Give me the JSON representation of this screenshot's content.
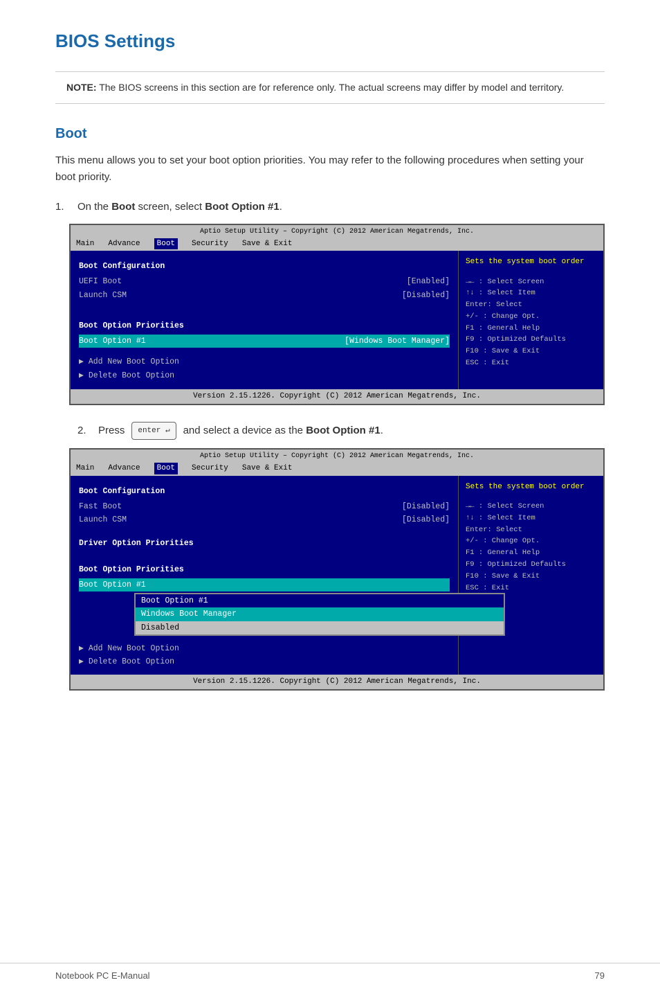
{
  "title": "BIOS Settings",
  "note": {
    "label": "NOTE:",
    "text": "The BIOS screens in this section are for reference only. The actual screens may differ by model and territory."
  },
  "section": {
    "title": "Boot",
    "description": "This menu allows you to set your boot option priorities. You may refer to the following procedures when setting your boot priority."
  },
  "steps": [
    {
      "num": "1.",
      "text": "On the ",
      "bold1": "Boot",
      "mid": " screen, select ",
      "bold2": "Boot Option #1",
      "end": "."
    },
    {
      "num": "2.",
      "text": "Press ",
      "enter_label": "enter ↵",
      "text2": " and select a device as the ",
      "bold": "Boot Option #1",
      "end": "."
    }
  ],
  "bios1": {
    "topbar_text": "Aptio Setup Utility – Copyright (C) 2012 American Megatrends, Inc.",
    "menu": [
      "Main",
      "Advance",
      "Boot",
      "Security",
      "Save & Exit"
    ],
    "active_menu": "Boot",
    "left": {
      "section1": "Boot Configuration",
      "rows1": [
        {
          "label": "UEFI Boot",
          "value": "[Enabled]"
        },
        {
          "label": "Launch CSM",
          "value": "[Disabled]"
        }
      ],
      "section2": "Boot Option Priorities",
      "rows2": [
        {
          "label": "Boot Option #1",
          "value": "[Windows Boot Manager]"
        }
      ],
      "links": [
        "Add New Boot Option",
        "Delete Boot Option"
      ]
    },
    "right": {
      "desc": "Sets the system boot order",
      "keys": [
        "→← : Select Screen",
        "↑↓  : Select Item",
        "Enter: Select",
        "+/- : Change Opt.",
        "F1  : General Help",
        "F9  : Optimized Defaults",
        "F10 : Save & Exit",
        "ESC : Exit"
      ]
    },
    "footer": "Version 2.15.1226. Copyright (C) 2012 American Megatrends, Inc."
  },
  "bios2": {
    "topbar_text": "Aptio Setup Utility – Copyright (C) 2012 American Megatrends, Inc.",
    "menu": [
      "Main",
      "Advance",
      "Boot",
      "Security",
      "Save & Exit"
    ],
    "active_menu": "Boot",
    "left": {
      "section1": "Boot Configuration",
      "rows1": [
        {
          "label": "Fast Boot",
          "value": "[Disabled]"
        },
        {
          "label": "Launch CSM",
          "value": "[Disabled]"
        }
      ],
      "section2": "Driver Option Priorities",
      "section3": "Boot Option Priorities",
      "rows3": [
        {
          "label": "Boot Option #1",
          "value": ""
        }
      ],
      "links": [
        "Add New Boot Option",
        "Delete Boot Option"
      ]
    },
    "popup": {
      "title": "Boot Option #1",
      "items": [
        "Windows Boot Manager",
        "Disabled"
      ],
      "selected_index": 0
    },
    "right": {
      "desc": "Sets the system boot order",
      "keys": [
        "→← : Select Screen",
        "↑↓  : Select Item",
        "Enter: Select",
        "+/- : Change Opt.",
        "F1  : General Help",
        "F9  : Optimized Defaults",
        "F10 : Save & Exit",
        "ESC : Exit"
      ]
    },
    "footer": "Version 2.15.1226. Copyright (C) 2012 American Megatrends, Inc."
  },
  "footer": {
    "left": "Notebook PC E-Manual",
    "right": "79"
  }
}
